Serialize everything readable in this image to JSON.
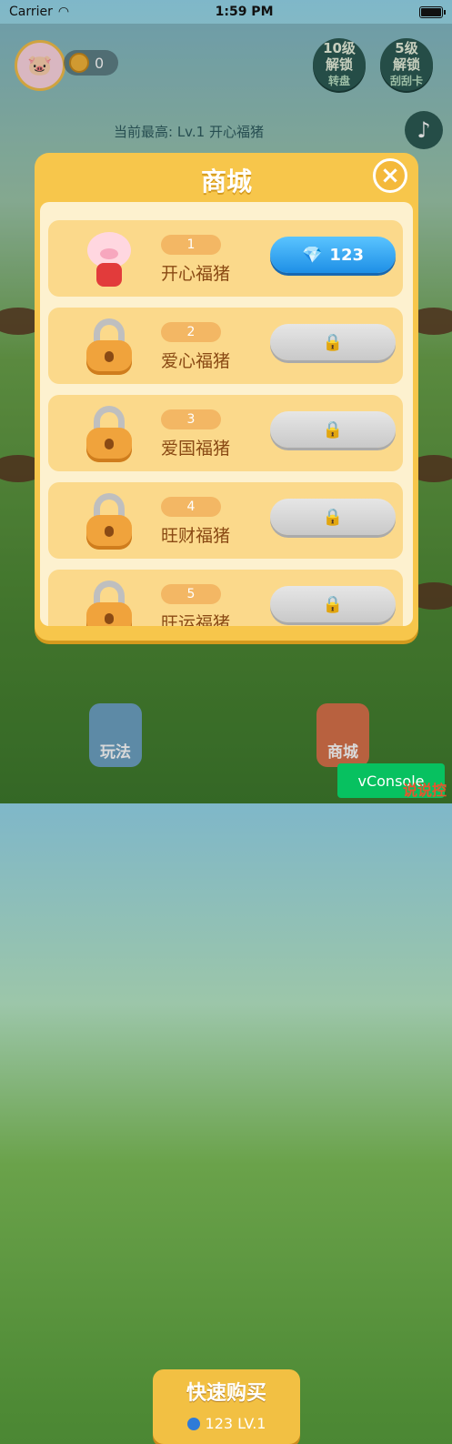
{
  "status": {
    "carrier": "Carrier",
    "time": "1:59 PM"
  },
  "header": {
    "coins": "0",
    "badge_10": {
      "line1": "10级",
      "line2": "解锁",
      "sub": "转盘"
    },
    "badge_5": {
      "line1": "5级",
      "line2": "解锁",
      "sub": "刮刮卡"
    },
    "record": "当前最高: Lv.1  开心福猪"
  },
  "modal": {
    "title": "商城",
    "items": [
      {
        "num": "1",
        "name": "开心福猪",
        "price": "123",
        "locked": false
      },
      {
        "num": "2",
        "name": "爱心福猪",
        "price": "",
        "locked": true
      },
      {
        "num": "3",
        "name": "爱国福猪",
        "price": "",
        "locked": true
      },
      {
        "num": "4",
        "name": "旺财福猪",
        "price": "",
        "locked": true
      },
      {
        "num": "5",
        "name": "旺运福猪",
        "price": "",
        "locked": true
      }
    ]
  },
  "bottom": {
    "help_label": "玩法",
    "quick_title": "快速购买",
    "quick_price": "123 LV.1",
    "shop_label": "商城",
    "vconsole": "vConsole",
    "watermark": "说说控"
  }
}
